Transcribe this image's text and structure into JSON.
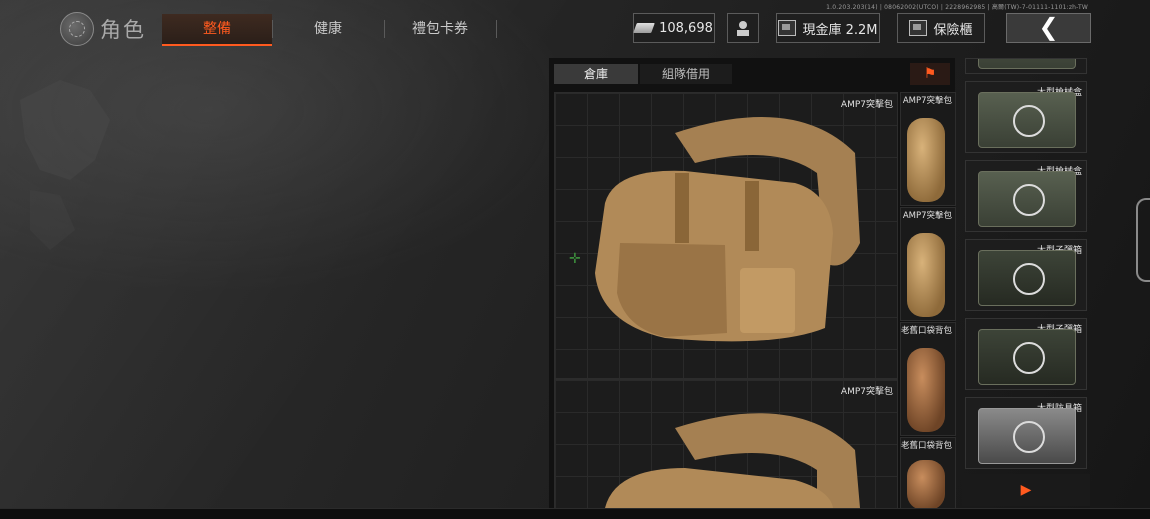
{
  "version_text": "1.0.203.203(14) | 08062002(UTCO) | 2228962985 | 高爾(TW)-7-01111-1101:zh-TW",
  "header": {
    "title": "角色",
    "tabs": [
      {
        "label": "整備",
        "active": true
      },
      {
        "label": "健康",
        "active": false
      },
      {
        "label": "禮包卡券",
        "active": false
      }
    ],
    "cash": "108,698",
    "cash_vault_label": "現金庫 2.2M",
    "safe_label": "保險櫃",
    "back_icon": "chevron-left-icon"
  },
  "storage": {
    "subtabs": [
      {
        "label": "倉庫",
        "active": true
      },
      {
        "label": "組隊借用",
        "active": false
      }
    ],
    "filter_icon": "filter-icon",
    "large_items": [
      {
        "label": "AMP7突擊包"
      },
      {
        "label": "AMP7突擊包"
      }
    ],
    "small_items": [
      {
        "label": "AMP7突擊包",
        "color": "tan"
      },
      {
        "label": "AMP7突擊包",
        "color": "tan"
      },
      {
        "label": "老舊口袋背包",
        "color": "brown"
      },
      {
        "label": "老舊口袋背包",
        "color": "brown"
      }
    ]
  },
  "right_column": {
    "items": [
      {
        "label": "大型槍械盒"
      },
      {
        "label": "大型槍械盒"
      },
      {
        "label": "大型子彈箱"
      },
      {
        "label": "大型子彈箱"
      },
      {
        "label": "大型防具箱"
      }
    ],
    "next_icon": "play-right-icon"
  },
  "colors": {
    "accent": "#ff5a1f",
    "panel_bg": "#111111"
  }
}
